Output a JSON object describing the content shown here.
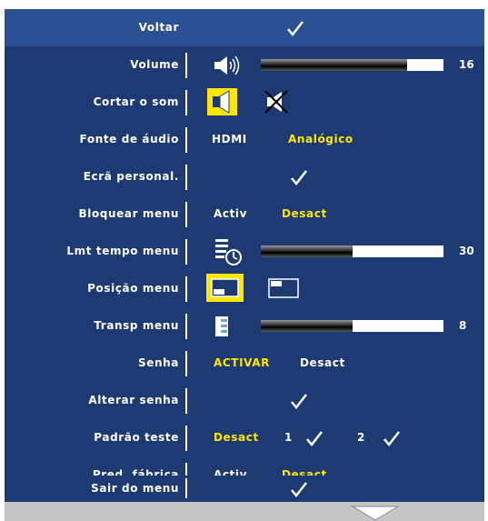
{
  "menu": {
    "back": {
      "label": "Voltar"
    },
    "volume": {
      "label": "Volume",
      "level": 16,
      "max": 20,
      "value_text": "16",
      "icon": "speaker-icon"
    },
    "mute": {
      "label": "Cortar o som",
      "options": [
        "speaker-on-icon",
        "speaker-muted-icon"
      ],
      "selected": 0
    },
    "audio_source": {
      "label": "Fonte de áudio",
      "opt1": "HDMI",
      "opt2": "Analógico",
      "selected": "Analógico"
    },
    "custom_screen": {
      "label": "Ecrã personal."
    },
    "menu_lock": {
      "label": "Bloquear menu",
      "opt1": "Activ",
      "opt2": "Desact",
      "selected": "Desact"
    },
    "menu_timeout": {
      "label": "Lmt tempo menu",
      "level": 30,
      "max": 60,
      "value_text": "30",
      "icon": "timer-icon"
    },
    "menu_position": {
      "label": "Posição menu",
      "options": [
        "position-bottom-left-icon",
        "position-top-left-icon"
      ],
      "selected": 0
    },
    "menu_transparency": {
      "label": "Transp menu",
      "level": 8,
      "max": 16,
      "value_text": "8",
      "icon": "transparency-icon"
    },
    "password": {
      "label": "Senha",
      "opt1": "ACTIVAR",
      "opt2": "Desact",
      "selected": "ACTIVAR"
    },
    "change_password": {
      "label": "Alterar senha"
    },
    "test_pattern": {
      "label": "Padrão teste",
      "opt0": "Desact",
      "opt1": "1",
      "opt2": "2",
      "selected": "Desact"
    },
    "factory_reset": {
      "label": "Pred. fábrica",
      "opt1": "Activ",
      "opt2": "Desact",
      "selected": "Desact"
    },
    "exit_menu": {
      "label": "Sair do menu"
    }
  },
  "colors": {
    "panel": "#1d3a73",
    "selected_row": "#2c5192",
    "highlight": "#ffe600",
    "text": "#ffffff"
  },
  "scroll_icon": "down-arrow-icon"
}
